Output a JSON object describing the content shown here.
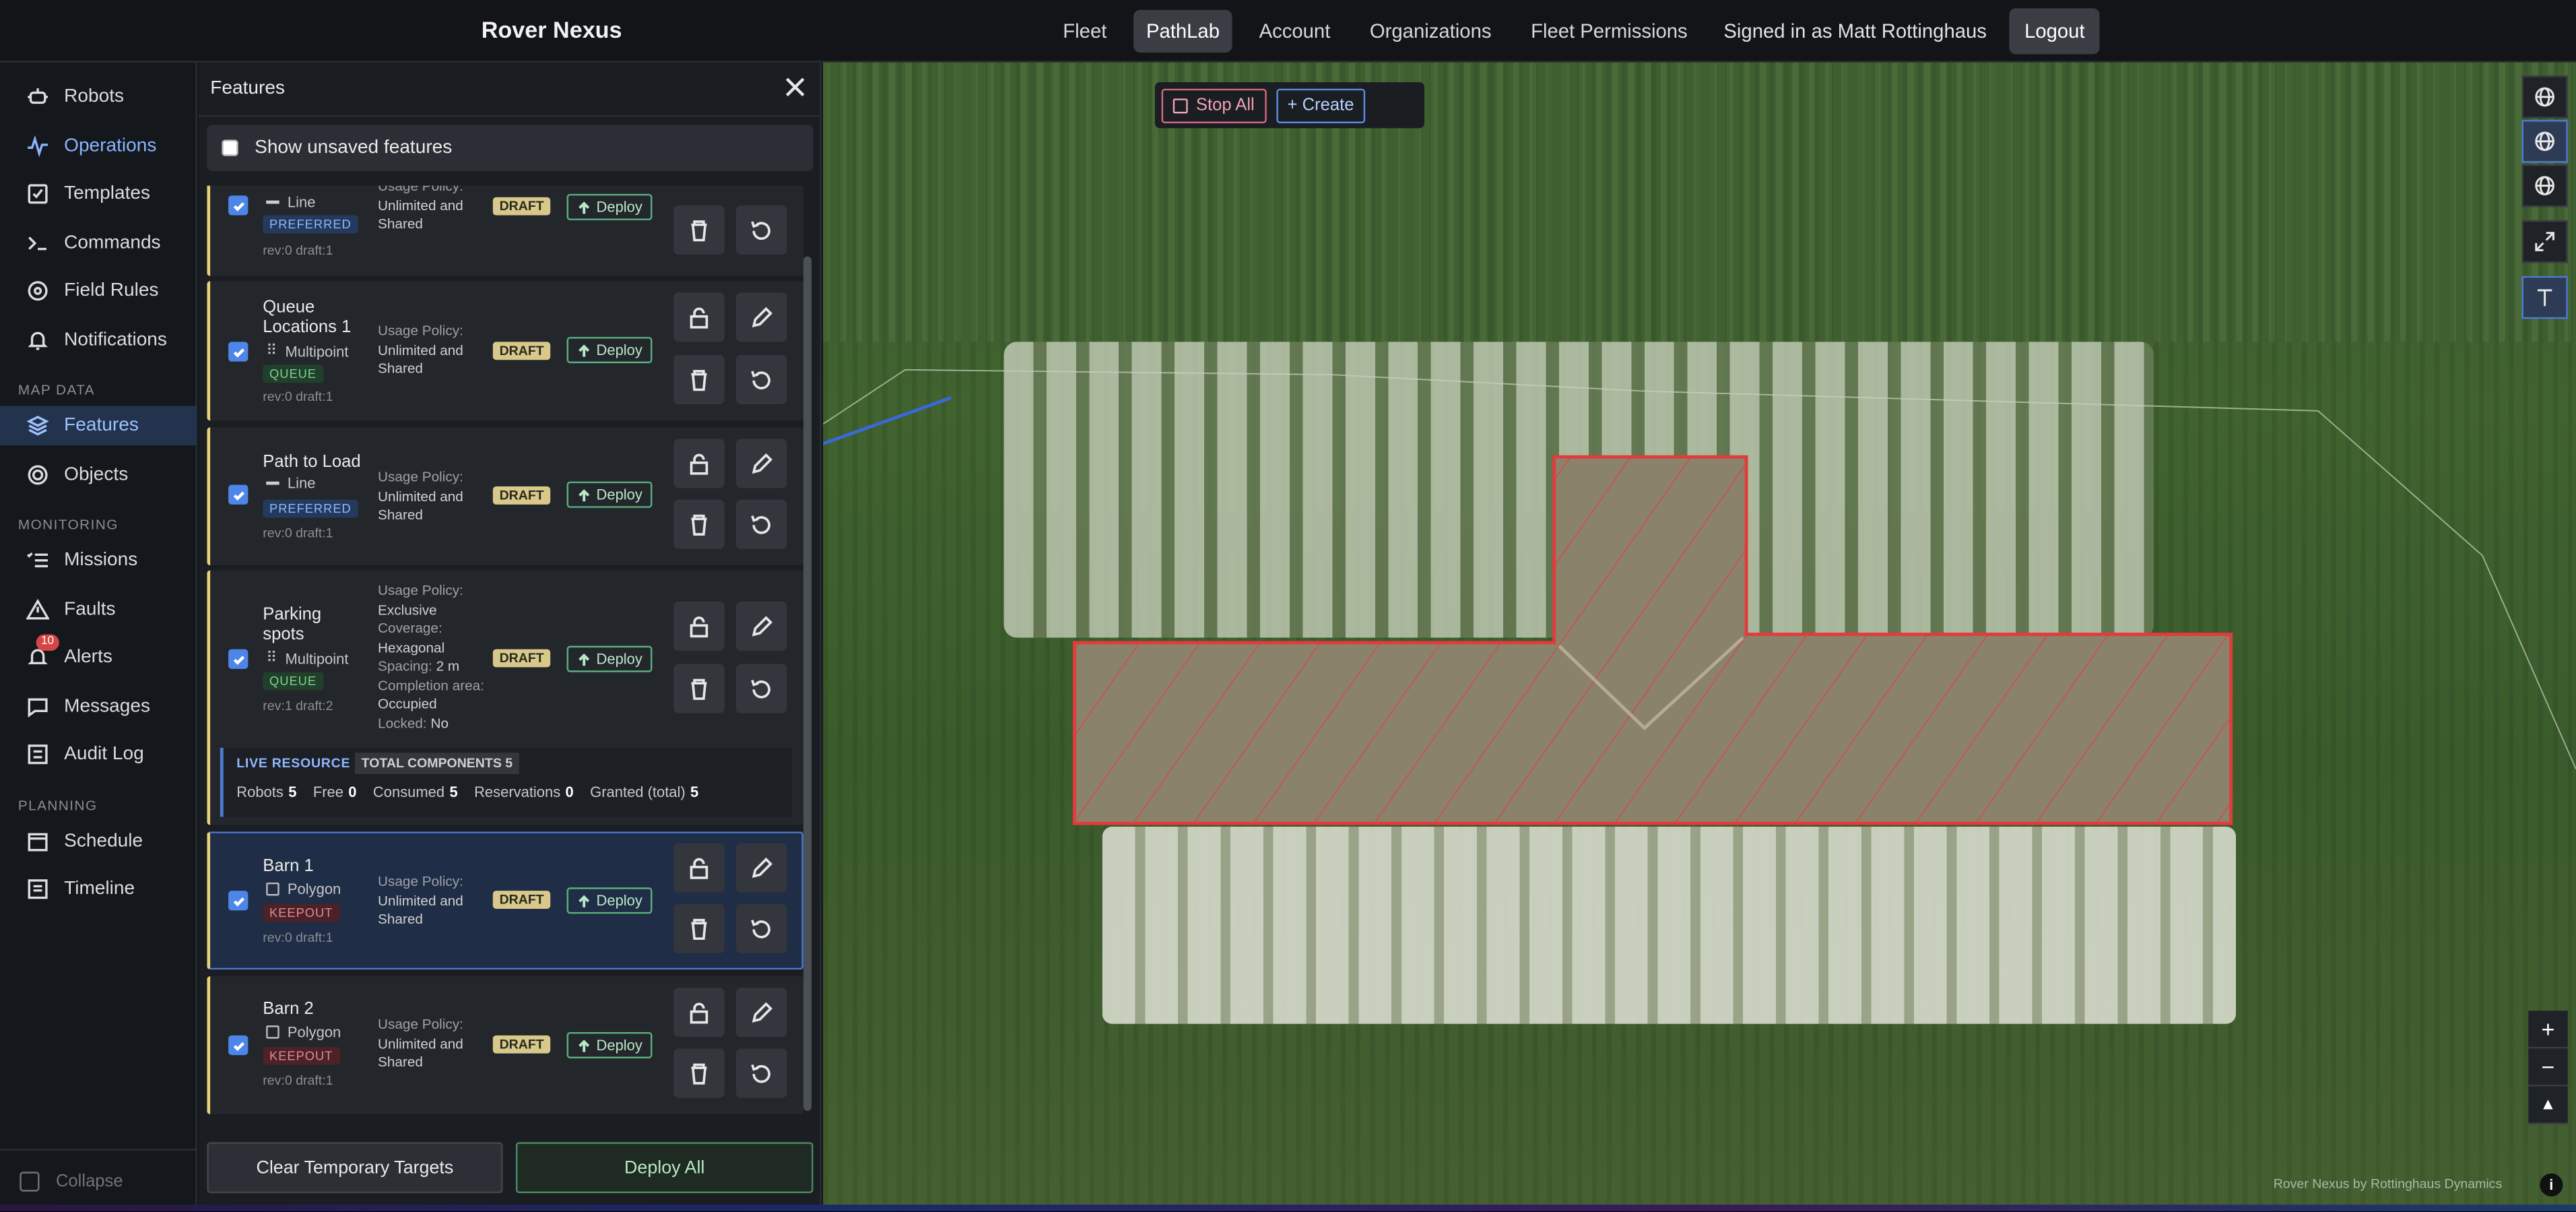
{
  "app": {
    "brand": "Rover Nexus"
  },
  "nav": {
    "items": [
      "Fleet",
      "PathLab",
      "Account",
      "Organizations",
      "Fleet Permissions"
    ],
    "active": "PathLab",
    "signed_in": "Signed in as Matt Rottinghaus",
    "logout": "Logout"
  },
  "sidebar": {
    "items": [
      {
        "label": "Robots",
        "icon": "robot-icon"
      },
      {
        "label": "Operations",
        "icon": "pulse-icon"
      },
      {
        "label": "Templates",
        "icon": "checkbox-icon"
      },
      {
        "label": "Commands",
        "icon": "terminal-icon"
      },
      {
        "label": "Field Rules",
        "icon": "target-icon"
      },
      {
        "label": "Notifications",
        "icon": "bell-icon"
      },
      {
        "label": "Features",
        "icon": "layers-icon"
      },
      {
        "label": "Objects",
        "icon": "circle-target-icon"
      },
      {
        "label": "Missions",
        "icon": "list-check-icon"
      },
      {
        "label": "Faults",
        "icon": "warning-icon"
      },
      {
        "label": "Alerts",
        "icon": "bell-icon"
      },
      {
        "label": "Messages",
        "icon": "message-icon"
      },
      {
        "label": "Audit Log",
        "icon": "log-icon"
      },
      {
        "label": "Schedule",
        "icon": "calendar-icon"
      },
      {
        "label": "Timeline",
        "icon": "timeline-icon"
      }
    ],
    "sections": [
      "MAP DATA",
      "MONITORING",
      "PLANNING"
    ],
    "alerts_badge": "10",
    "collapse": "Collapse"
  },
  "panel": {
    "title": "Features",
    "show_unsaved": "Show unsaved features",
    "features": [
      {
        "name": "",
        "type": "Line",
        "tag": "PREFERRED",
        "rev": "rev:0 draft:1",
        "policy_label": "Usage Policy:",
        "policy": "Unlimited and Shared",
        "status": "DRAFT",
        "deploy": "Deploy"
      },
      {
        "name": "Queue Locations 1",
        "type": "Multipoint",
        "tag": "QUEUE",
        "rev": "rev:0 draft:1",
        "policy_label": "Usage Policy:",
        "policy": "Unlimited and Shared",
        "status": "DRAFT",
        "deploy": "Deploy"
      },
      {
        "name": "Path to Load",
        "type": "Line",
        "tag": "PREFERRED",
        "rev": "rev:0 draft:1",
        "policy_label": "Usage Policy:",
        "policy": "Unlimited and Shared",
        "status": "DRAFT",
        "deploy": "Deploy"
      },
      {
        "name": "Parking spots",
        "type": "Multipoint",
        "tag": "QUEUE",
        "rev": "rev:1 draft:2",
        "policy_label": "Usage Policy:",
        "policy": "Exclusive",
        "coverage_label": "Coverage:",
        "coverage": "Hexagonal",
        "spacing_label": "Spacing:",
        "spacing": "2 m",
        "completion_label": "Completion area:",
        "completion": "Occupied",
        "locked_label": "Locked:",
        "locked": "No",
        "status": "DRAFT",
        "deploy": "Deploy"
      },
      {
        "name": "Barn 1",
        "type": "Polygon",
        "tag": "KEEPOUT",
        "rev": "rev:0 draft:1",
        "policy_label": "Usage Policy:",
        "policy": "Unlimited and Shared",
        "status": "DRAFT",
        "deploy": "Deploy"
      },
      {
        "name": "Barn 2",
        "type": "Polygon",
        "tag": "KEEPOUT",
        "rev": "rev:0 draft:1",
        "policy_label": "Usage Policy:",
        "policy": "Unlimited and Shared",
        "status": "DRAFT",
        "deploy": "Deploy"
      }
    ],
    "live_resource": {
      "label": "LIVE RESOURCE",
      "components": "TOTAL COMPONENTS 5",
      "robots_label": "Robots",
      "robots": "5",
      "free_label": "Free",
      "free": "0",
      "consumed_label": "Consumed",
      "consumed": "5",
      "reservations_label": "Reservations",
      "reservations": "0",
      "granted_label": "Granted (total)",
      "granted": "5"
    },
    "clear_button": "Clear Temporary Targets",
    "deploy_all_button": "Deploy All"
  },
  "map": {
    "stop_all": "Stop All",
    "create": "+ Create",
    "zoom_in": "+",
    "zoom_out": "−",
    "compass": "▲",
    "attribution": "Rover Nexus by Rottinghaus Dynamics",
    "info": "i",
    "keepout_color": "#e23b3b"
  }
}
